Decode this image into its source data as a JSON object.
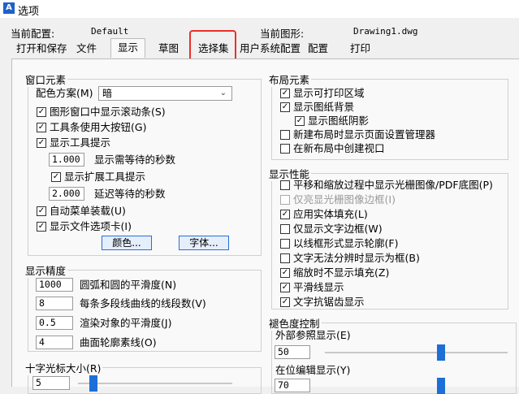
{
  "window": {
    "title": "选项",
    "icon": "app-logo-icon"
  },
  "header": {
    "config_label": "当前配置:",
    "config_value": "Default",
    "drawing_label": "当前图形:",
    "drawing_value": "Drawing1.dwg"
  },
  "tabs": [
    "打开和保存",
    "文件",
    "显示",
    "草图",
    "选择集",
    "用户系统配置",
    "配置",
    "打印"
  ],
  "window_elements": {
    "title": "窗口元素",
    "scheme_label": "配色方案(M)",
    "scheme_value": "暗",
    "show_scrollbars": "图形窗口中显示滚动条(S)",
    "large_buttons": "工具条使用大按钮(G)",
    "show_tooltips": "显示工具提示",
    "tooltip_delay_value": "1.000",
    "tooltip_delay_label": "显示需等待的秒数",
    "show_extended_tips": "显示扩展工具提示",
    "extended_delay_value": "2.000",
    "extended_delay_label": "延迟等待的秒数",
    "auto_menu": "自动菜单装载(U)",
    "file_tabs": "显示文件选项卡(I)",
    "color_button": "颜色...",
    "font_button": "字体..."
  },
  "display_precision": {
    "title": "显示精度",
    "rows": [
      {
        "value": "1000",
        "label": "圆弧和圆的平滑度(N)"
      },
      {
        "value": "8",
        "label": "每条多段线曲线的线段数(V)"
      },
      {
        "value": "0.5",
        "label": "渲染对象的平滑度(J)"
      },
      {
        "value": "4",
        "label": "曲面轮廓素线(O)"
      }
    ]
  },
  "crosshair": {
    "title": "十字光标大小(R)",
    "value": "5"
  },
  "layout_elements": {
    "title": "布局元素",
    "items": [
      {
        "label": "显示可打印区域",
        "checked": true
      },
      {
        "label": "显示图纸背景",
        "checked": true
      },
      {
        "label": "显示图纸阴影",
        "checked": true
      },
      {
        "label": "新建布局时显示页面设置管理器",
        "checked": false
      },
      {
        "label": "在新布局中创建视口",
        "checked": false
      }
    ]
  },
  "display_performance": {
    "title": "显示性能",
    "items": [
      {
        "label": "平移和缩放过程中显示光栅图像/PDF底图(P)",
        "checked": false,
        "disabled": false
      },
      {
        "label": "仅亮显光栅图像边框(I)",
        "checked": false,
        "disabled": true
      },
      {
        "label": "应用实体填充(L)",
        "checked": true,
        "disabled": false
      },
      {
        "label": "仅显示文字边框(W)",
        "checked": false,
        "disabled": false
      },
      {
        "label": "以线框形式显示轮廓(F)",
        "checked": false,
        "disabled": false
      },
      {
        "label": "文字无法分辨时显示为框(B)",
        "checked": false,
        "disabled": false
      },
      {
        "label": "缩放时不显示填充(Z)",
        "checked": true,
        "disabled": false
      },
      {
        "label": "平滑线显示",
        "checked": true,
        "disabled": false
      },
      {
        "label": "文字抗锯齿显示",
        "checked": true,
        "disabled": false
      }
    ]
  },
  "fade_control": {
    "title": "褪色度控制",
    "xref_label": "外部参照显示(E)",
    "xref_value": "50",
    "xref_level": 50,
    "inplace_label": "在位编辑显示(Y)",
    "inplace_value": "70",
    "inplace_level": 70
  },
  "colors": {
    "accent": "#1e6ed8",
    "highlight": "#e8312a"
  }
}
